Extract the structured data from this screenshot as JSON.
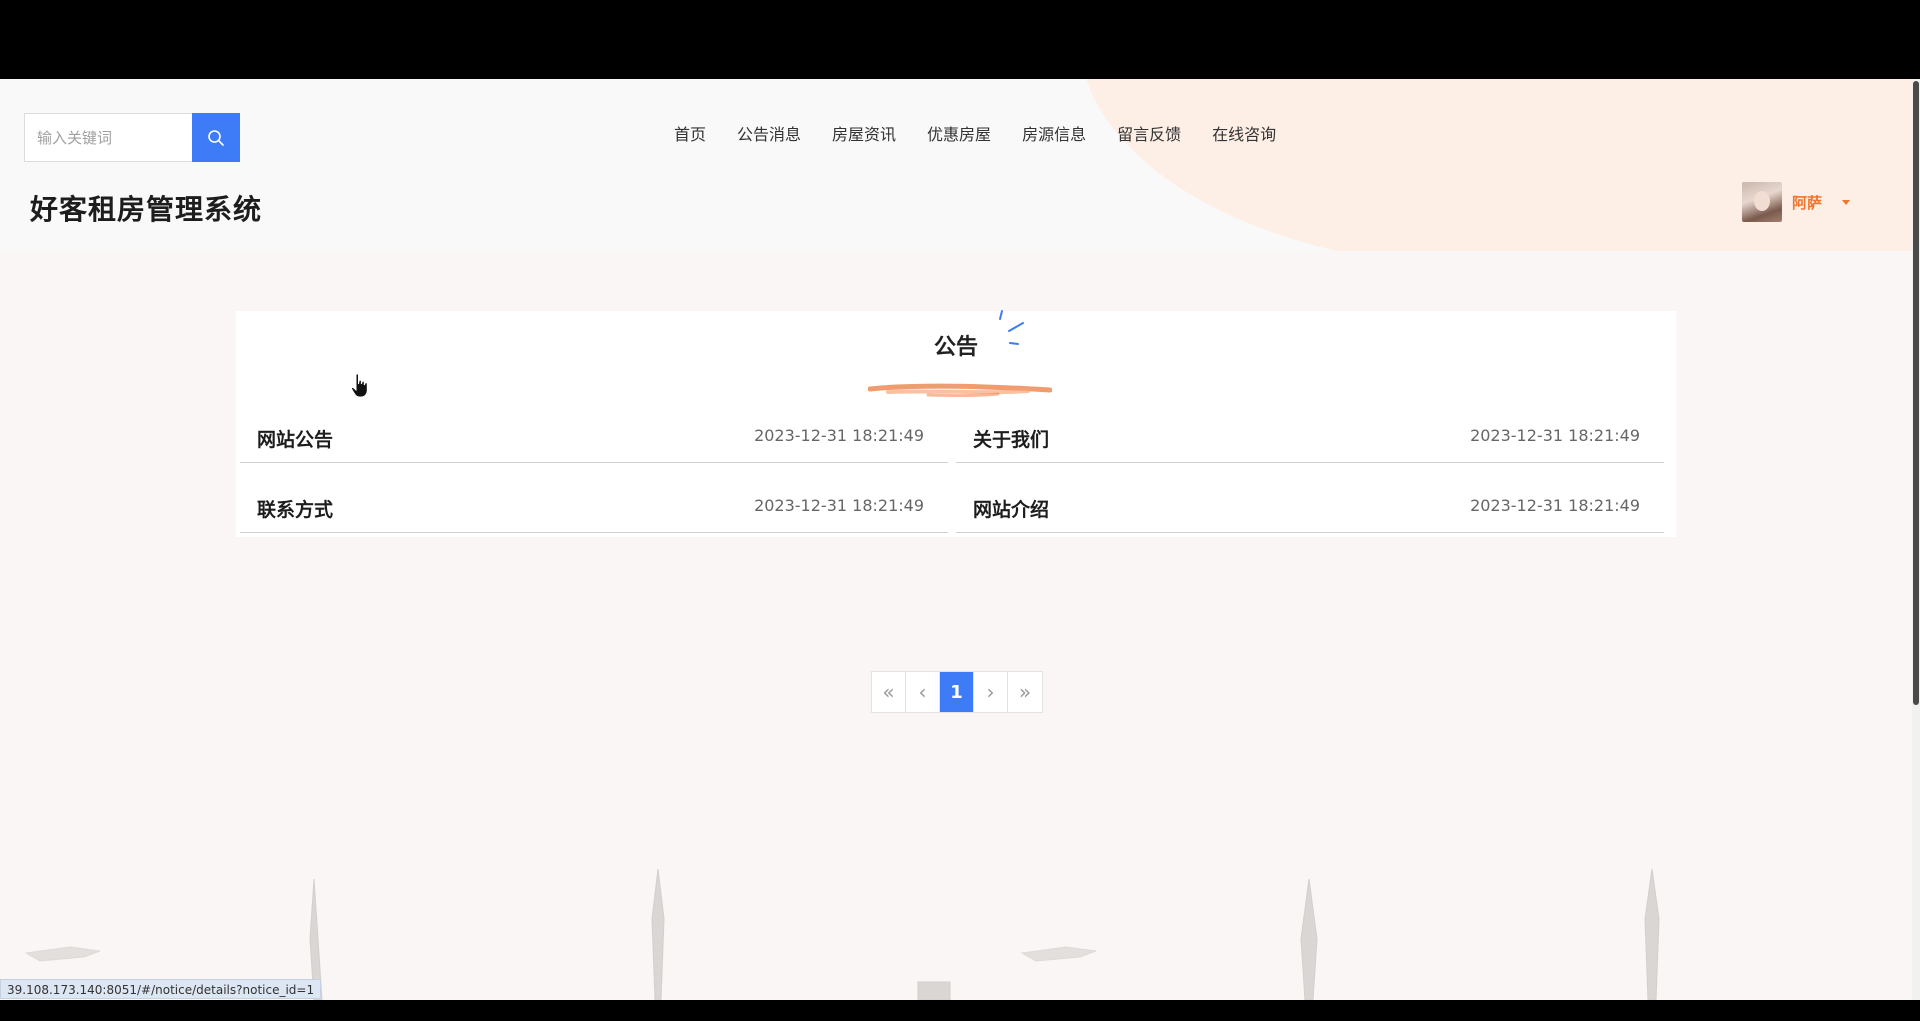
{
  "search": {
    "placeholder": "输入关键词"
  },
  "nav": {
    "items": [
      {
        "label": "首页"
      },
      {
        "label": "公告消息"
      },
      {
        "label": "房屋资讯"
      },
      {
        "label": "优惠房屋"
      },
      {
        "label": "房源信息"
      },
      {
        "label": "留言反馈"
      },
      {
        "label": "在线咨询"
      }
    ]
  },
  "site": {
    "title": "好客租房管理系统"
  },
  "user": {
    "name": "阿萨"
  },
  "section": {
    "title": "公告"
  },
  "notices": [
    {
      "title": "网站公告",
      "date": "2023-12-31 18:21:49"
    },
    {
      "title": "关于我们",
      "date": "2023-12-31 18:21:49"
    },
    {
      "title": "联系方式",
      "date": "2023-12-31 18:21:49"
    },
    {
      "title": "网站介绍",
      "date": "2023-12-31 18:21:49"
    }
  ],
  "pagination": {
    "first": "«",
    "prev": "‹",
    "current": "1",
    "next": "›",
    "last": "»"
  },
  "status_bar": {
    "url": "39.108.173.140:8051/#/notice/details?notice_id=1"
  },
  "colors": {
    "accent": "#3d7bf7",
    "user": "#f0752f",
    "brush": "#f08a55"
  }
}
